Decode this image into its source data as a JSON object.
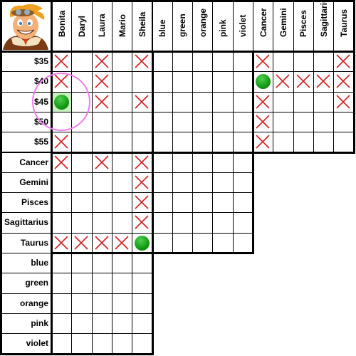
{
  "avatar": {
    "icon": "cartoon-aviator-avatar-icon"
  },
  "columns": {
    "names": [
      "Bonita",
      "Daryl",
      "Laura",
      "Mario",
      "Sheila"
    ],
    "colors": [
      "blue",
      "green",
      "orange",
      "pink",
      "violet"
    ],
    "signs": [
      "Cancer",
      "Gemini",
      "Pisces",
      "Sagittarius",
      "Taurus"
    ]
  },
  "rows": {
    "prices": [
      "$35",
      "$40",
      "$45",
      "$50",
      "$55"
    ],
    "signs": [
      "Cancer",
      "Gemini",
      "Pisces",
      "Sagittarius",
      "Taurus"
    ],
    "colors": [
      "blue",
      "green",
      "orange",
      "pink",
      "violet"
    ]
  },
  "marks_legend": {
    "x": "excluded",
    "o": "confirmed"
  },
  "colors": {
    "x_mark": "#d42020",
    "dot": "#1aa51a",
    "highlight_cell": "#c8f0c0",
    "focus_ring": "#f07cf0"
  },
  "grid": {
    "prices_vs_names": [
      [
        "x",
        "",
        "x",
        "",
        "x"
      ],
      [
        "x",
        "",
        "x",
        "",
        ""
      ],
      [
        "o",
        "",
        "x",
        "",
        "x"
      ],
      [
        "",
        "",
        "",
        "",
        ""
      ],
      [
        "x",
        "",
        "",
        "",
        ""
      ]
    ],
    "prices_vs_colors": [
      [
        "",
        "",
        "",
        "",
        ""
      ],
      [
        "",
        "",
        "",
        "",
        ""
      ],
      [
        "",
        "",
        "",
        "",
        ""
      ],
      [
        "",
        "",
        "",
        "",
        ""
      ],
      [
        "",
        "",
        "",
        "",
        ""
      ]
    ],
    "prices_vs_signs": [
      [
        "x",
        "",
        "",
        "",
        "x"
      ],
      [
        "o",
        "x",
        "x",
        "x",
        "x"
      ],
      [
        "x",
        "",
        "",
        "",
        "x"
      ],
      [
        "x",
        "",
        "",
        "",
        ""
      ],
      [
        "x",
        "",
        "",
        "",
        ""
      ]
    ],
    "signs_vs_names": [
      [
        "x",
        "",
        "x",
        "",
        "x"
      ],
      [
        "",
        "",
        "",
        "",
        "x"
      ],
      [
        "",
        "",
        "",
        "",
        "x"
      ],
      [
        "",
        "",
        "",
        "",
        "x"
      ],
      [
        "x",
        "x",
        "x",
        "x",
        "o"
      ]
    ],
    "signs_vs_colors": [
      [
        "",
        "",
        "",
        "",
        ""
      ],
      [
        "",
        "",
        "",
        "",
        ""
      ],
      [
        "",
        "",
        "",
        "",
        ""
      ],
      [
        "",
        "",
        "",
        "",
        ""
      ],
      [
        "",
        "",
        "",
        "",
        ""
      ]
    ],
    "colors_vs_names": [
      [
        "",
        "",
        "",
        "",
        ""
      ],
      [
        "",
        "",
        "",
        "",
        ""
      ],
      [
        "",
        "",
        "",
        "",
        ""
      ],
      [
        "",
        "",
        "",
        "",
        ""
      ],
      [
        "",
        "",
        "",
        "",
        ""
      ]
    ]
  },
  "selection": {
    "row": "$45",
    "column": "Bonita"
  }
}
